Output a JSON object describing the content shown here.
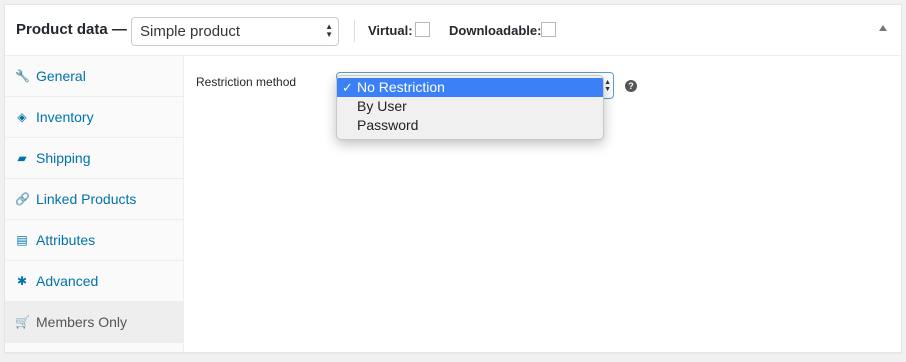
{
  "header": {
    "title": "Product data —",
    "product_type": "Simple product",
    "virtual_label": "Virtual:",
    "virtual_checked": false,
    "downloadable_label": "Downloadable:",
    "downloadable_checked": false
  },
  "tabs": [
    {
      "label": "General",
      "icon": "wrench-icon",
      "glyph": "🔧"
    },
    {
      "label": "Inventory",
      "icon": "tag-icon",
      "glyph": "◈"
    },
    {
      "label": "Shipping",
      "icon": "truck-icon",
      "glyph": "▰"
    },
    {
      "label": "Linked Products",
      "icon": "link-icon",
      "glyph": "🔗"
    },
    {
      "label": "Attributes",
      "icon": "list-icon",
      "glyph": "▤"
    },
    {
      "label": "Advanced",
      "icon": "gear-icon",
      "glyph": "✱"
    },
    {
      "label": "Members Only",
      "icon": "cart-icon",
      "glyph": "🛒",
      "active": true
    }
  ],
  "restriction": {
    "label": "Restriction method",
    "options": [
      "No Restriction",
      "By User",
      "Password"
    ],
    "selected": "No Restriction",
    "check_glyph": "✓",
    "help_glyph": "?"
  },
  "colors": {
    "accent": "#0073aa",
    "selected_option": "#3b80f6"
  }
}
